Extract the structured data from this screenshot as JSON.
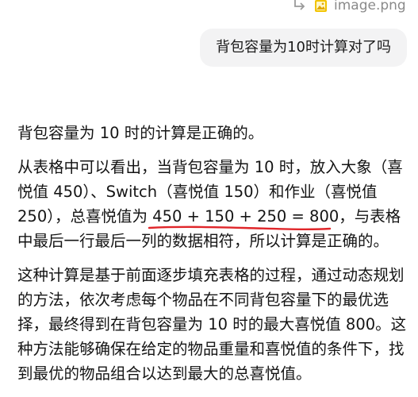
{
  "attachment": {
    "filename": "image.png",
    "icon": "reply-arrow-icon",
    "file_icon": "image-file-icon",
    "file_icon_color": "#e8b800"
  },
  "user_message": {
    "text": "背包容量为10时计算对了吗"
  },
  "assistant_message": {
    "paragraph1": "背包容量为 10 时的计算是正确的。",
    "paragraph2": {
      "before": "从表格中可以看出，当背包容量为 10 时，放入大象（喜悦值 450）、Switch（喜悦值 150）和作业（喜悦值 250），总喜悦值为 ",
      "highlight": "450 + 150 + 250 = 800，",
      "after": "与表格中最后一行最后一列的数据相符，所以计算是正确的。",
      "highlight_color": "#e0262a"
    },
    "paragraph3": "这种计算是基于前面逐步填充表格的过程，通过动态规划的方法，依次考虑每个物品在不同背包容量下的最优选择，最终得到在背包容量为 10 时的最大喜悦值 800。这种方法能够确保在给定的物品重量和喜悦值的条件下，找到最优的物品组合以达到最大的总喜悦值。"
  }
}
